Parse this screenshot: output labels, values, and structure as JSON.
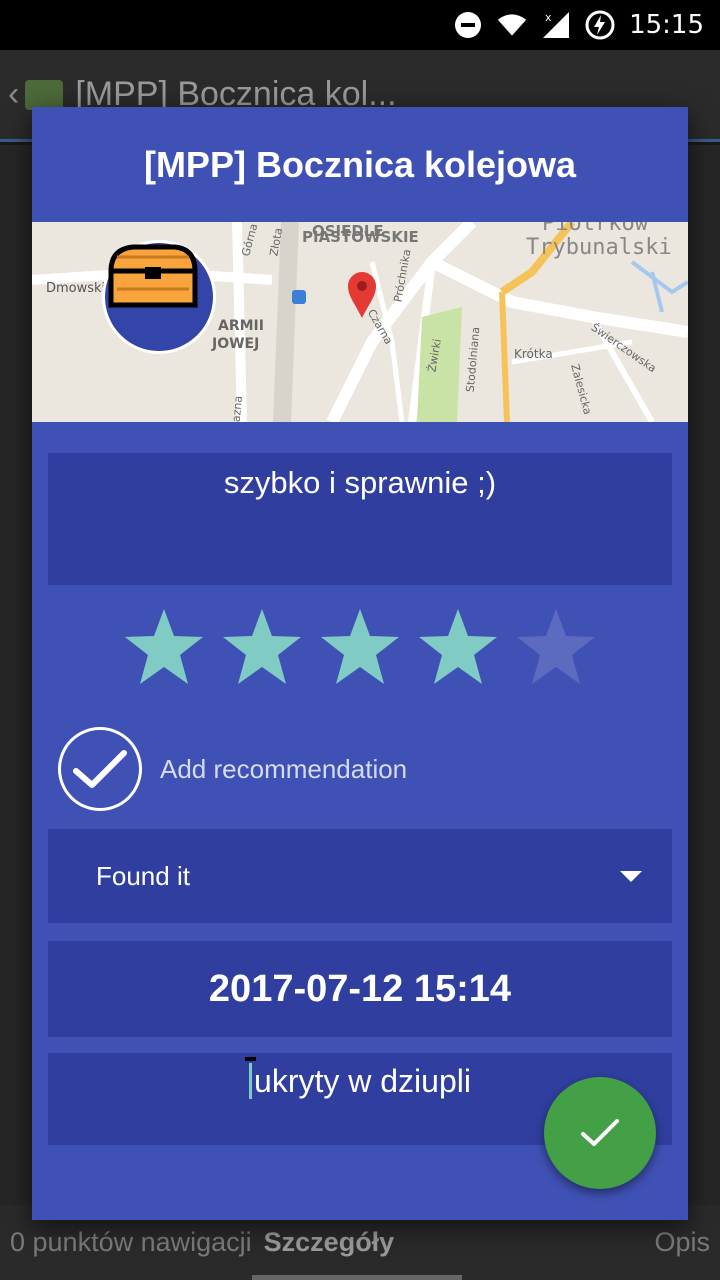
{
  "status_bar": {
    "time": "15:15",
    "icons": [
      "dnd-icon",
      "wifi-icon",
      "signal-icon",
      "battery-charging-icon"
    ]
  },
  "background": {
    "app_title": "[MPP] Bocznica kol...",
    "tabs": {
      "left": "0 punktów nawigacji",
      "active": "Szczegóły",
      "right": "Opis"
    }
  },
  "dialog": {
    "title": "[MPP] Bocznica kolejowa",
    "map": {
      "labels": {
        "osiedle": "OSIEDLE",
        "piastowskie": "PIASTOWSKIE",
        "piotrkow": "Piotrków",
        "trybunalski": "Trybunalski",
        "dmowski": "Dmowski",
        "armii": "ARMII",
        "krajowej": "JOWEJ",
        "gorna": "Górna",
        "zlota": "Złota",
        "prochnika": "Próchnika",
        "czarna": "Czarna",
        "zwirki": "Żwirki",
        "stodolniana": "Stodolniana",
        "krotka": "Krótka",
        "zalesicka": "Zalesicka",
        "swierczowska": "Świerczowska",
        "azna": "azna"
      }
    },
    "comment": "szybko i sprawnie ;)",
    "rating": {
      "value": 4,
      "max": 5
    },
    "recommendation_label": "Add recommendation",
    "log_type": "Found it",
    "datetime": "2017-07-12 15:14",
    "note": "ukryty w dziupli",
    "colors": {
      "dialog": "#3f51b5",
      "field": "#303f9f",
      "star_on": "#80cbc4",
      "star_off": "#5c6bc0",
      "fab": "#43a047"
    }
  }
}
